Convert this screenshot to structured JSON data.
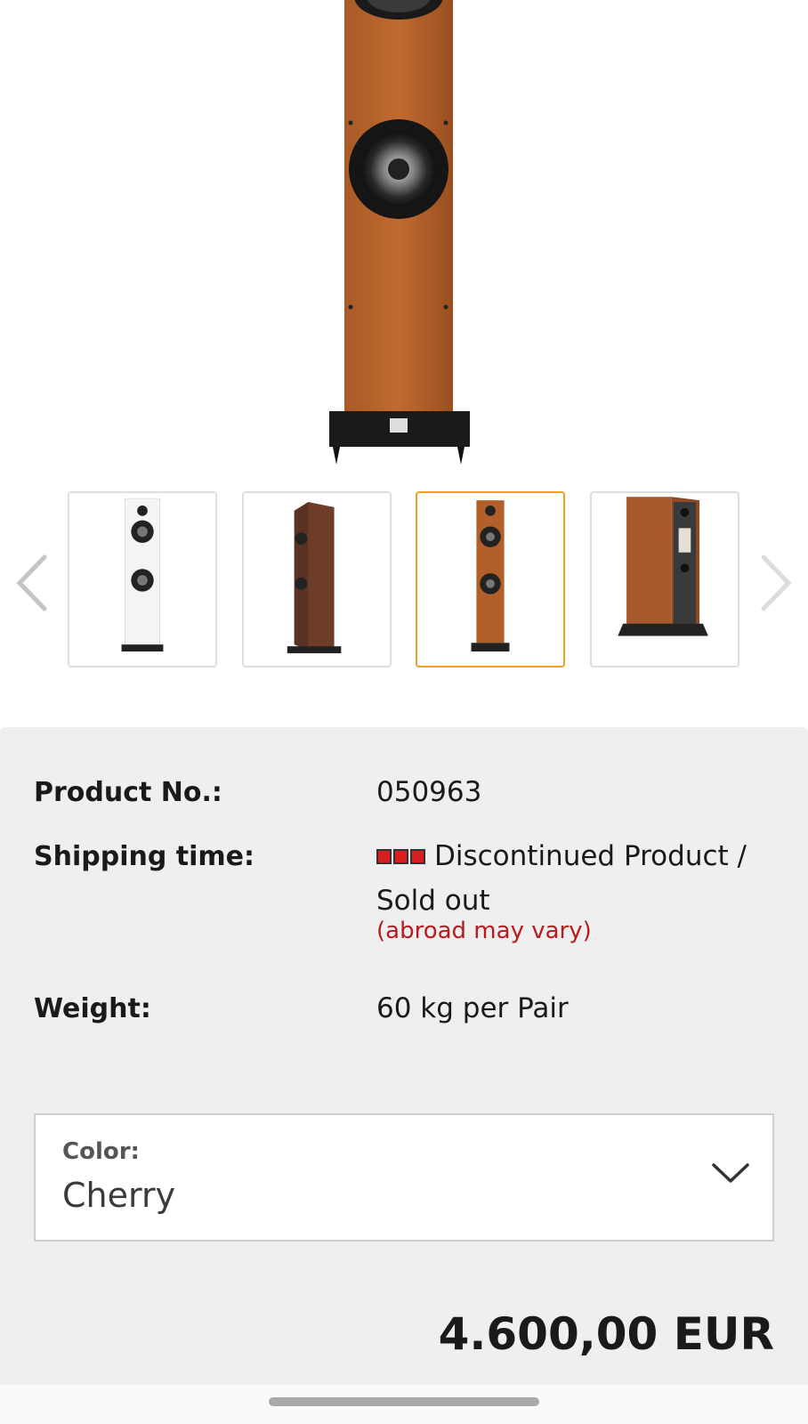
{
  "gallery": {
    "thumbnails": [
      {
        "name": "white-finish",
        "active": false
      },
      {
        "name": "walnut-finish",
        "active": false
      },
      {
        "name": "cherry-finish",
        "active": true
      },
      {
        "name": "rear-view",
        "active": false
      }
    ],
    "icons": {
      "prev": "chevron-left-icon",
      "next": "chevron-right-icon"
    },
    "accent_color": "#f0a020"
  },
  "details": {
    "product_no_label": "Product No.:",
    "product_no_value": "050963",
    "shipping_label": "Shipping time:",
    "shipping_value": "Discontinued Product / Sold out",
    "shipping_note": "(abroad may vary)",
    "shipping_status_color": "#d81f1f",
    "weight_label": "Weight:",
    "weight_value": "60 kg per Pair"
  },
  "color_select": {
    "label": "Color:",
    "value": "Cherry"
  },
  "price": {
    "amount": "4.600,00 EUR"
  }
}
